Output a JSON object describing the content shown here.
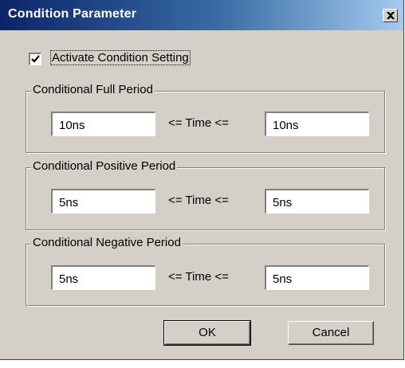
{
  "window": {
    "title": "Condition Parameter"
  },
  "activate": {
    "label": "Activate Condition Setting",
    "checked": true
  },
  "groups": [
    {
      "title": "Conditional Full Period",
      "min": "10ns",
      "max": "10ns",
      "relation": "<= Time <="
    },
    {
      "title": "Conditional Positive Period",
      "min": "5ns",
      "max": "5ns",
      "relation": "<= Time <="
    },
    {
      "title": "Conditional Negative Period",
      "min": "5ns",
      "max": "5ns",
      "relation": "<= Time <="
    }
  ],
  "buttons": {
    "ok": "OK",
    "cancel": "Cancel"
  },
  "icons": {
    "close": "close-icon",
    "check": "checkmark-icon"
  },
  "colors": {
    "title_start": "#0a246a",
    "title_end": "#a6caf0",
    "face": "#d4d0c8"
  }
}
